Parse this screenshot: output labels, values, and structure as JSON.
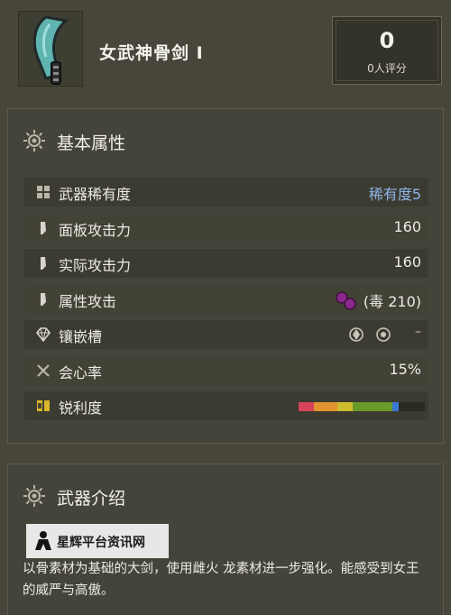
{
  "header": {
    "weapon_name": "女武神骨剑 I",
    "rating_value": "0",
    "rating_label": "0人评分"
  },
  "basic": {
    "title": "基本属性",
    "rows": {
      "rarity": {
        "label": "武器稀有度",
        "value": "稀有度5"
      },
      "display_attack": {
        "label": "面板攻击力",
        "value": "160"
      },
      "true_attack": {
        "label": "实际攻击力",
        "value": "160"
      },
      "element": {
        "label": "属性攻击",
        "value": "(毒 210)"
      },
      "slots": {
        "label": "镶嵌槽",
        "value": "–"
      },
      "affinity": {
        "label": "会心率",
        "value": "15%"
      },
      "sharpness": {
        "label": "锐利度",
        "segments": [
          {
            "color": "#d9435a",
            "fraction": 0.12
          },
          {
            "color": "#e0932e",
            "fraction": 0.19
          },
          {
            "color": "#cdbd2e",
            "fraction": 0.12
          },
          {
            "color": "#6a9a2a",
            "fraction": 0.31
          },
          {
            "color": "#3c78d6",
            "fraction": 0.05
          },
          {
            "color": "#2a2922",
            "fraction": 0.21
          }
        ]
      }
    }
  },
  "intro": {
    "title": "武器介绍",
    "text": "以骨素材为基础的大剑，使用雌火 龙素材进一步强化。能感受到女王 的威严与高傲。",
    "watermark": "星辉平台资讯网"
  },
  "colors": {
    "background": "#48463a",
    "panel": "#45443a",
    "rarity_blue": "#8fb3e8",
    "poison_purple": "#8b2a8c"
  },
  "icons": {
    "weapon": "great-sword-icon",
    "section": "gear-emblem-icon",
    "rarity": "grid-icon",
    "attack": "blade-icon",
    "slots": "gem-icon",
    "affinity": "crossed-swords-icon",
    "sharpness": "whetstone-icon"
  }
}
